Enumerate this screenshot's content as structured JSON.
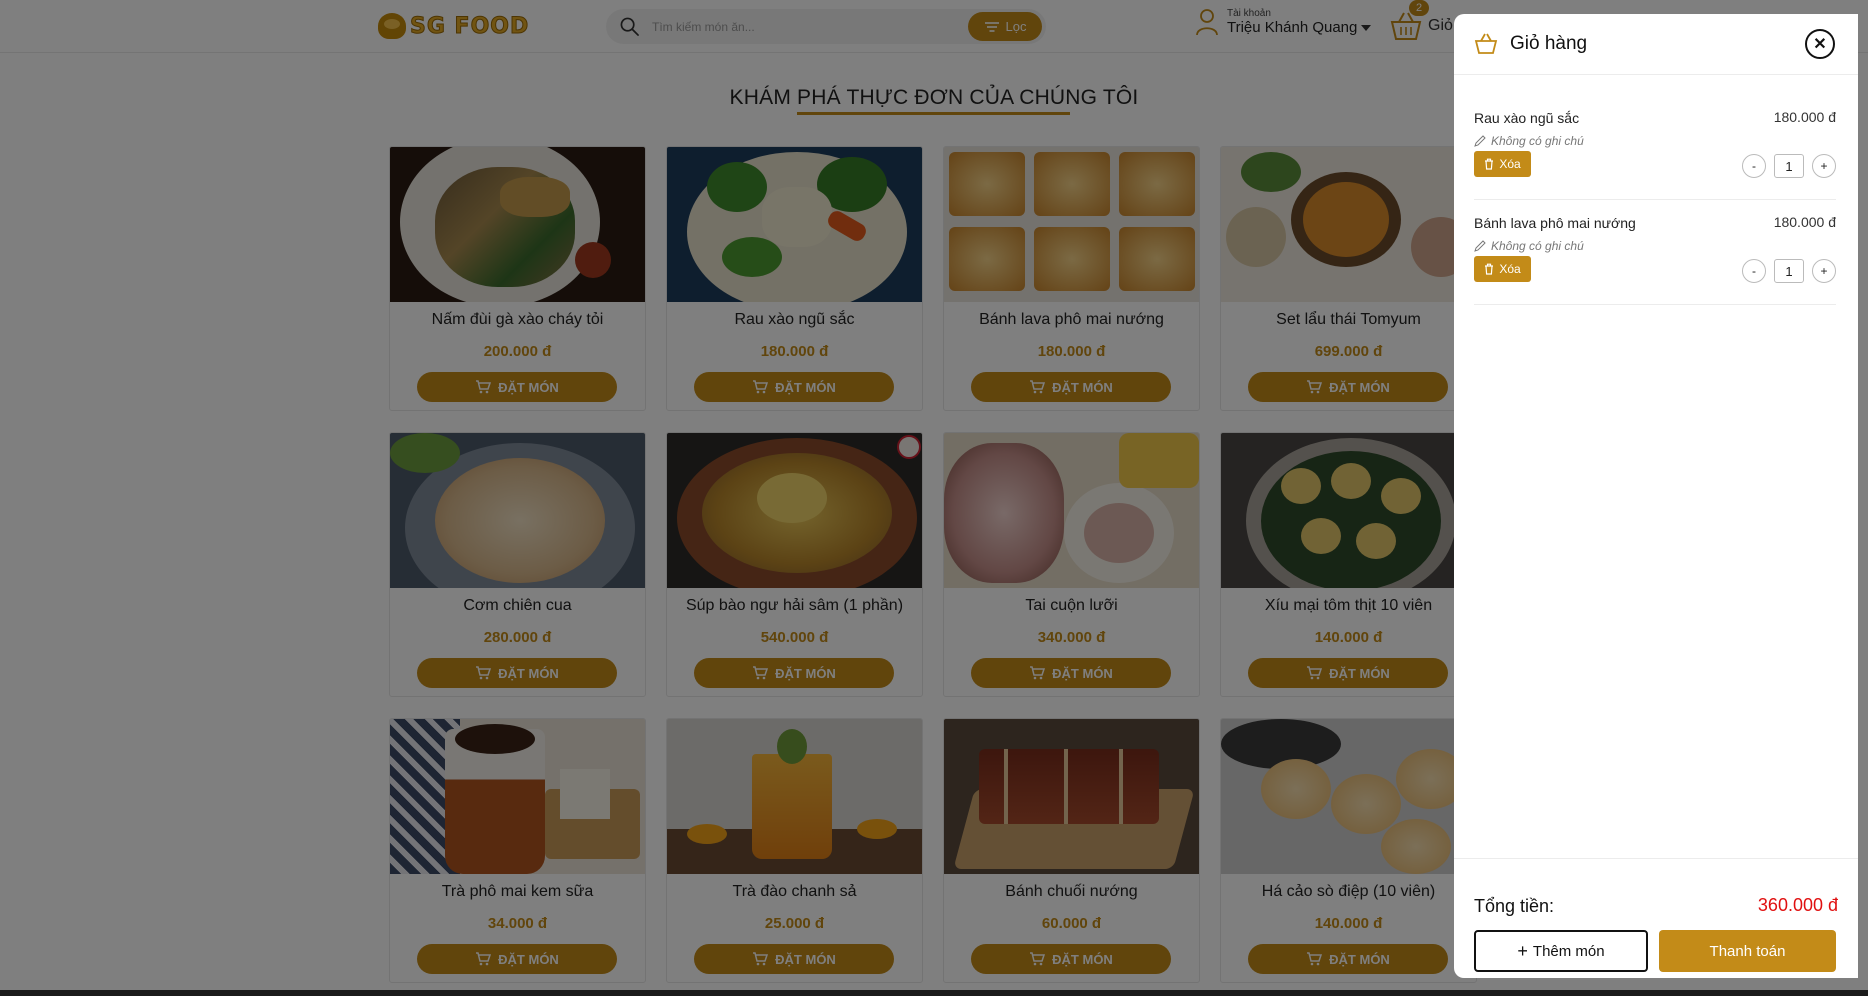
{
  "colors": {
    "accent": "#c38b18",
    "price": "#c38b18",
    "total": "#e01010"
  },
  "header": {
    "logo_text": "SG FOOD",
    "search_placeholder": "Tìm kiếm món ăn...",
    "filter_label": "Lọc",
    "account_small": "Tài khoản",
    "account_name": "Triệu Khánh Quang",
    "cart_count": "2",
    "cart_label": "Giỏ"
  },
  "menu": {
    "title": "KHÁM PHÁ THỰC ĐƠN CỦA CHÚNG TÔI",
    "order_label": "ĐẶT MÓN",
    "items": [
      {
        "name": "Nấm đùi gà xào cháy tỏi",
        "price": "200.000 đ",
        "icon": "mushroom-dish"
      },
      {
        "name": "Rau xào ngũ sắc",
        "price": "180.000 đ",
        "icon": "vegetable-dish"
      },
      {
        "name": "Bánh lava phô mai nướng",
        "price": "180.000 đ",
        "icon": "cheese-lava-dish"
      },
      {
        "name": "Set lẩu thái Tomyum",
        "price": "699.000 đ",
        "icon": "hotpot-set"
      },
      {
        "name": "Cơm chiên cua",
        "price": "280.000 đ",
        "icon": "fried-rice"
      },
      {
        "name": "Súp bào ngư hải sâm (1 phần)",
        "price": "540.000 đ",
        "icon": "abalone-soup"
      },
      {
        "name": "Tai cuộn lưỡi",
        "price": "340.000 đ",
        "icon": "ear-tongue-roll"
      },
      {
        "name": "Xíu mại tôm thịt 10 viên",
        "price": "140.000 đ",
        "icon": "shumai"
      },
      {
        "name": "Trà phô mai kem sữa",
        "price": "34.000 đ",
        "icon": "cheese-tea"
      },
      {
        "name": "Trà đào chanh sả",
        "price": "25.000 đ",
        "icon": "peach-tea"
      },
      {
        "name": "Bánh chuối nướng",
        "price": "60.000 đ",
        "icon": "banana-cake"
      },
      {
        "name": "Há cảo sò điệp (10 viên)",
        "price": "140.000 đ",
        "icon": "har-gow"
      }
    ]
  },
  "cart": {
    "title": "Giỏ hàng",
    "delete_label": "Xóa",
    "no_note_label": "Không có ghi chú",
    "items": [
      {
        "name": "Rau xào ngũ sắc",
        "price": "180.000 đ",
        "qty": "1"
      },
      {
        "name": "Bánh lava phô mai nướng",
        "price": "180.000 đ",
        "qty": "1"
      }
    ],
    "minus_label": "-",
    "plus_label": "+",
    "total_label": "Tổng tiền:",
    "total_value": "360.000 đ",
    "add_more_label": "Thêm món",
    "checkout_label": "Thanh toán"
  }
}
